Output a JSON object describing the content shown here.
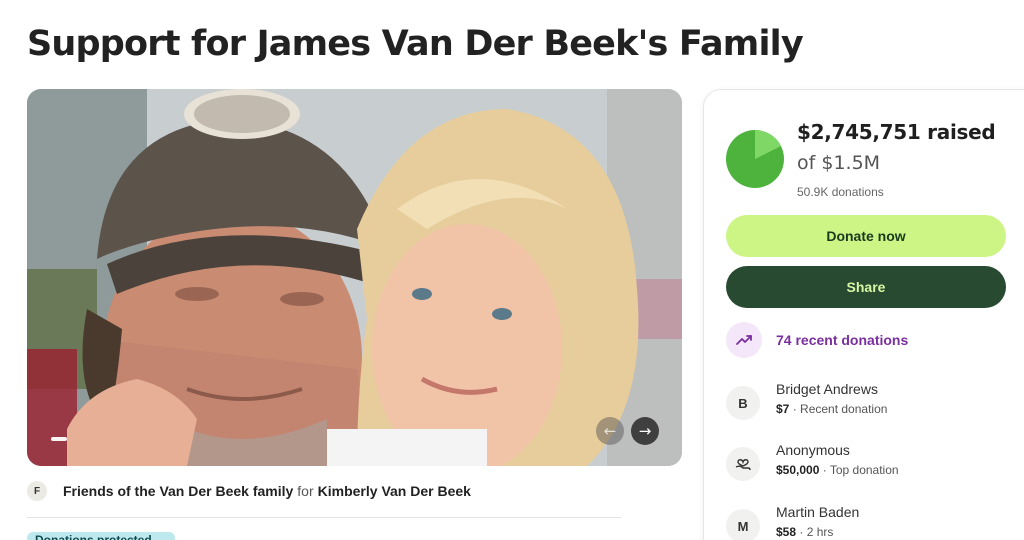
{
  "page": {
    "title": "Support for James Van Der Beek's Family"
  },
  "gallery": {
    "prev_icon": "arrow-left-icon",
    "next_icon": "arrow-right-icon",
    "prev_glyph": "←",
    "next_glyph": "→"
  },
  "organizer": {
    "avatar_initial": "F",
    "name": "Friends of the Van Der Beek family",
    "for_text": "for",
    "beneficiary": "Kimberly Van Der Beek"
  },
  "badge_peek": {
    "label": "Donations protected"
  },
  "fundraiser": {
    "raised": "$2,745,751 raised",
    "goal": "of $1.5M",
    "donations": "50.9K donations",
    "progress_fraction": 1.0,
    "progress_color": "#5ec44a"
  },
  "actions": {
    "donate_label": "Donate now",
    "share_label": "Share"
  },
  "recent": {
    "label": "74 recent donations",
    "icon": "trending-up-icon"
  },
  "donors": [
    {
      "initial": "B",
      "name": "Bridget Andrews",
      "amount": "$7",
      "note": " · Recent donation"
    },
    {
      "initial": "",
      "icon": "heart-hand-icon",
      "name": "Anonymous",
      "amount": "$50,000",
      "note": " · Top donation"
    },
    {
      "initial": "M",
      "name": "Martin Baden",
      "amount": "$58",
      "note": " · 2 hrs"
    }
  ],
  "colors": {
    "donate_bg": "#cdf585",
    "share_bg": "#274a30",
    "accent_purple": "#7a2fa0"
  }
}
